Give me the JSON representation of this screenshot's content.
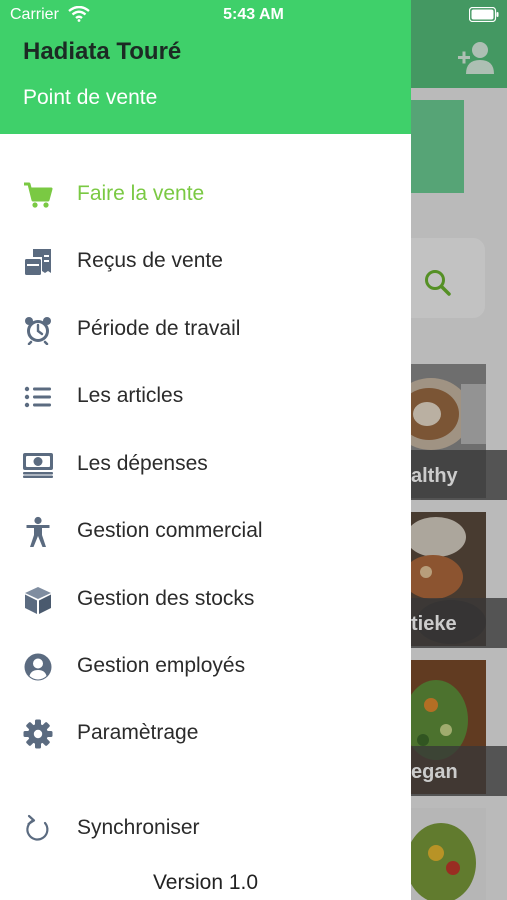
{
  "status_bar": {
    "carrier": "Carrier",
    "time": "5:43 AM"
  },
  "drawer": {
    "user_name": "Hadiata Touré",
    "user_role": "Point de vente",
    "menu": [
      {
        "label": "Faire la vente",
        "icon": "cart-icon",
        "active": true
      },
      {
        "label": "Reçus de vente",
        "icon": "receipt-icon"
      },
      {
        "label": "Période de travail",
        "icon": "alarm-clock-icon"
      },
      {
        "label": "Les articles",
        "icon": "list-icon"
      },
      {
        "label": "Les dépenses",
        "icon": "money-icon"
      },
      {
        "label": "Gestion commercial",
        "icon": "person-icon"
      },
      {
        "label": "Gestion des stocks",
        "icon": "box-icon"
      },
      {
        "label": "Gestion employés",
        "icon": "user-circle-icon"
      },
      {
        "label": "Paramètrage",
        "icon": "gear-icon"
      }
    ],
    "sync_label": "Synchroniser",
    "version": "Version 1.0"
  },
  "background": {
    "categories": [
      {
        "label": "althy"
      },
      {
        "label": "tieke"
      },
      {
        "label": "egan"
      }
    ]
  },
  "colors": {
    "header_green": "#3fd06a",
    "active_green": "#7ac943",
    "icon_gray": "#5b6b80"
  }
}
